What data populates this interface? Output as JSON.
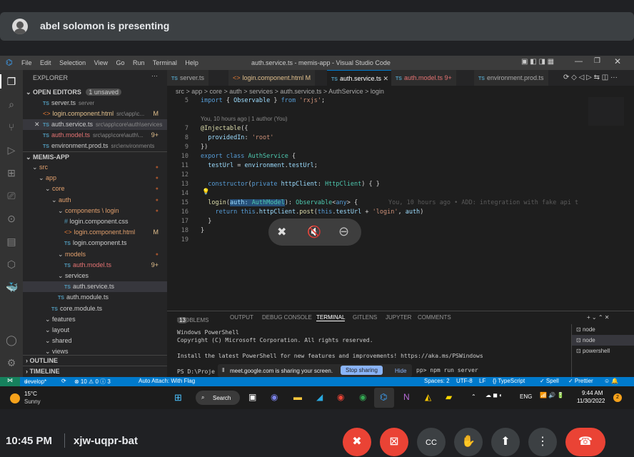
{
  "meet": {
    "presenter_text": "abel solomon is presenting",
    "time": "10:45 PM",
    "meeting_code": "xjw-uqpr-bat"
  },
  "vscode": {
    "title": "auth.service.ts - memis-app - Visual Studio Code",
    "menu": [
      "File",
      "Edit",
      "Selection",
      "View",
      "Go",
      "Run",
      "Terminal",
      "Help"
    ],
    "explorer_label": "EXPLORER",
    "open_editors_label": "OPEN EDITORS",
    "unsaved_badge": "1 unsaved",
    "open_editors": [
      {
        "name": "server.ts",
        "path": "server",
        "type": "ts"
      },
      {
        "name": "login.component.html",
        "path": "src\\app\\c...",
        "badge": "M",
        "type": "html"
      },
      {
        "name": "auth.service.ts",
        "path": "src\\app\\core\\auth\\services",
        "type": "ts",
        "active": true
      },
      {
        "name": "auth.model.ts",
        "path": "src\\app\\core\\auth\\...",
        "badge": "9+",
        "type": "ts"
      },
      {
        "name": "environment.prod.ts",
        "path": "src\\environments",
        "type": "ts"
      }
    ],
    "project_label": "MEMIS-APP",
    "tree": [
      {
        "label": "src",
        "indent": 1,
        "folder": true
      },
      {
        "label": "app",
        "indent": 2,
        "folder": true
      },
      {
        "label": "core",
        "indent": 3,
        "folder": true
      },
      {
        "label": "auth",
        "indent": 4,
        "folder": true
      },
      {
        "label": "components \\ login",
        "indent": 5,
        "folder": true
      },
      {
        "label": "login.component.css",
        "indent": 6,
        "type": "css"
      },
      {
        "label": "login.component.html",
        "indent": 6,
        "type": "html",
        "badge": "M"
      },
      {
        "label": "login.component.ts",
        "indent": 6,
        "type": "ts"
      },
      {
        "label": "models",
        "indent": 5,
        "folder": true
      },
      {
        "label": "auth.model.ts",
        "indent": 6,
        "type": "ts",
        "badge": "9+"
      },
      {
        "label": "services",
        "indent": 5,
        "folder": true
      },
      {
        "label": "auth.service.ts",
        "indent": 6,
        "type": "ts"
      },
      {
        "label": "auth.module.ts",
        "indent": 5,
        "type": "ts"
      },
      {
        "label": "core.module.ts",
        "indent": 4,
        "type": "ts"
      },
      {
        "label": "features",
        "indent": 3,
        "folder": true
      },
      {
        "label": "layout",
        "indent": 3,
        "folder": true
      },
      {
        "label": "shared",
        "indent": 3,
        "folder": true
      },
      {
        "label": "views",
        "indent": 3,
        "folder": true
      }
    ],
    "outline_label": "OUTLINE",
    "timeline_label": "TIMELINE",
    "tabs": [
      {
        "label": "server.ts",
        "type": "ts"
      },
      {
        "label": "login.component.html M",
        "type": "html"
      },
      {
        "label": "auth.service.ts",
        "type": "ts",
        "active": true
      },
      {
        "label": "auth.model.ts 9+",
        "type": "ts"
      },
      {
        "label": "environment.prod.ts",
        "type": "ts"
      }
    ],
    "breadcrumb": "src > app > core > auth > services > auth.service.ts > AuthService > login",
    "blame_header": "You, 10 hours ago | 1 author (You)",
    "code_lines": [
      {
        "n": "5",
        "text": "import { Observable } from 'rxjs';"
      },
      {
        "n": "7",
        "text": "@Injectable({"
      },
      {
        "n": "8",
        "text": "  providedIn: 'root'"
      },
      {
        "n": "9",
        "text": "})"
      },
      {
        "n": "10",
        "text": "export class AuthService {"
      },
      {
        "n": "11",
        "text": "  testUrl = environment.testUrl;"
      },
      {
        "n": "12",
        "text": ""
      },
      {
        "n": "13",
        "text": "  constructor(private httpClient: HttpClient) { }"
      },
      {
        "n": "14",
        "text": ""
      },
      {
        "n": "15",
        "text": "  login(auth: AuthModel): Observable<any> {"
      },
      {
        "n": "16",
        "text": "    return this.httpClient.post(this.testUrl + 'login', auth)"
      },
      {
        "n": "17",
        "text": "  }"
      },
      {
        "n": "18",
        "text": "}"
      },
      {
        "n": "19",
        "text": ""
      }
    ],
    "inline_blame": "You, 10 hours ago • ADD: integration with fake api t",
    "panel_tabs": [
      "PROBLEMS",
      "OUTPUT",
      "DEBUG CONSOLE",
      "TERMINAL",
      "GITLENS",
      "JUPYTER",
      "COMMENTS"
    ],
    "problems_count": "13",
    "terminal_lines": [
      "Windows PowerShell",
      "Copyright (C) Microsoft Corporation. All rights reserved.",
      "",
      "Install the latest PowerShell for new features and improvements! https://aka.ms/PSWindows",
      "",
      "PS D:\\Proje"
    ],
    "terminal_cmd": "pp> npm run server",
    "terminals": [
      "node",
      "node",
      "powershell"
    ],
    "status": {
      "branch": "develop*",
      "errors": "⊗ 10 ⚠ 0 ⓘ 3",
      "autoattach": "Auto Attach: With Flag",
      "spaces": "Spaces: 2",
      "encoding": "UTF-8",
      "eol": "LF",
      "lang": "{} TypeScript",
      "spell": "✓ Spell",
      "prettier": "✓ Prettier"
    },
    "share_text": "meet.google.com is sharing your screen.",
    "stop_sharing": "Stop sharing",
    "hide": "Hide"
  },
  "taskbar": {
    "temp": "15°C",
    "weather": "Sunny",
    "search": "Search",
    "lang": "ENG",
    "time": "9:44 AM",
    "date": "11/30/2022",
    "notif": "2"
  }
}
